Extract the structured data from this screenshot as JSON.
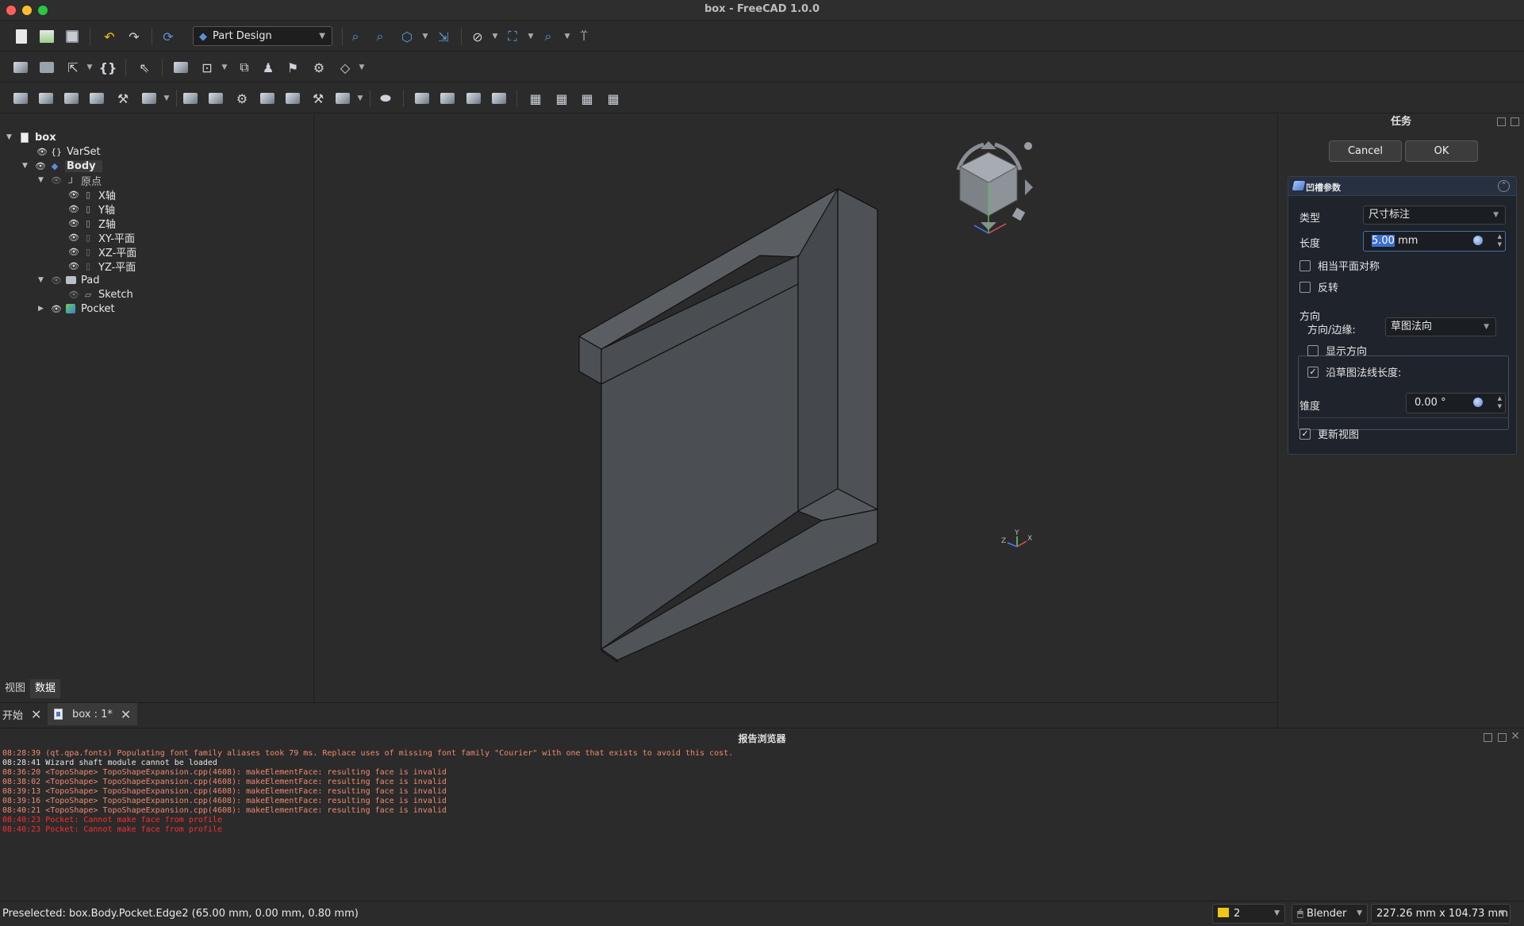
{
  "window": {
    "title": "box - FreeCAD 1.0.0"
  },
  "toolbar": {
    "workbench": "Part Design"
  },
  "tree": {
    "items": [
      {
        "label": "box"
      },
      {
        "label": "VarSet"
      },
      {
        "label": "Body"
      },
      {
        "label": "原点"
      },
      {
        "label": "X轴"
      },
      {
        "label": "Y轴"
      },
      {
        "label": "Z轴"
      },
      {
        "label": "XY-平面"
      },
      {
        "label": "XZ-平面"
      },
      {
        "label": "YZ-平面"
      },
      {
        "label": "Pad"
      },
      {
        "label": "Sketch"
      },
      {
        "label": "Pocket"
      }
    ],
    "tabs": {
      "view": "视图",
      "data": "数据"
    }
  },
  "task": {
    "title": "任务",
    "cancel": "Cancel",
    "ok": "OK",
    "group_title": "凹槽参数",
    "type_label": "类型",
    "type_value": "尺寸标注",
    "length_label": "长度",
    "length_value": "5.00",
    "length_unit": " mm",
    "symmetric_label": "相当平面对称",
    "symmetric_checked": false,
    "reversed_label": "反转",
    "reversed_checked": false,
    "direction_title": "方向",
    "direction_edge_label": "方向/边缘:",
    "direction_edge_value": "草图法向",
    "show_direction_label": "显示方向",
    "show_direction_checked": false,
    "along_normal_label": "沿草图法线长度:",
    "along_normal_checked": true,
    "taper_label": "锥度",
    "taper_value": "0.00 °",
    "update_view_label": "更新视图",
    "update_view_checked": true
  },
  "doc_tabs": {
    "start": "开始",
    "doc": "box : 1*"
  },
  "report": {
    "title": "报告浏览器",
    "lines": [
      {
        "time": "08:28:39",
        "text": "(qt.qpa.fonts) Populating font family aliases took 79 ms. Replace uses of missing font family \"Courier\" with one that exists to avoid this cost.",
        "level": "warn"
      },
      {
        "time": "08:28:41",
        "text": "Wizard shaft module cannot be loaded",
        "level": "msg"
      },
      {
        "time": "08:36:20",
        "text": "<TopoShape> TopoShapeExpansion.cpp(4608): makeElementFace: resulting face is invalid",
        "level": "warn"
      },
      {
        "time": "08:38:02",
        "text": "<TopoShape> TopoShapeExpansion.cpp(4608): makeElementFace: resulting face is invalid",
        "level": "warn"
      },
      {
        "time": "08:39:13",
        "text": "<TopoShape> TopoShapeExpansion.cpp(4608): makeElementFace: resulting face is invalid",
        "level": "warn"
      },
      {
        "time": "08:39:16",
        "text": "<TopoShape> TopoShapeExpansion.cpp(4608): makeElementFace: resulting face is invalid",
        "level": "warn"
      },
      {
        "time": "08:40:21",
        "text": "<TopoShape> TopoShapeExpansion.cpp(4608): makeElementFace: resulting face is invalid",
        "level": "warn"
      },
      {
        "time": "08:40:23",
        "text": "Pocket: Cannot make face from profile",
        "level": "err"
      },
      {
        "time": "08:40:23",
        "text": "Pocket: Cannot make face from profile",
        "level": "err"
      }
    ]
  },
  "status": {
    "preselected": "Preselected: box.Body.Pocket.Edge2 (65.00 mm, 0.00 mm, 0.80 mm)",
    "draw_style": "2",
    "draw_style_color": "#f0c419",
    "navigation": "Blender",
    "dimensions": "227.26 mm x 104.73 mm"
  },
  "colors": {
    "background": "#2b2b2b",
    "accent": "#3d6fd1"
  }
}
